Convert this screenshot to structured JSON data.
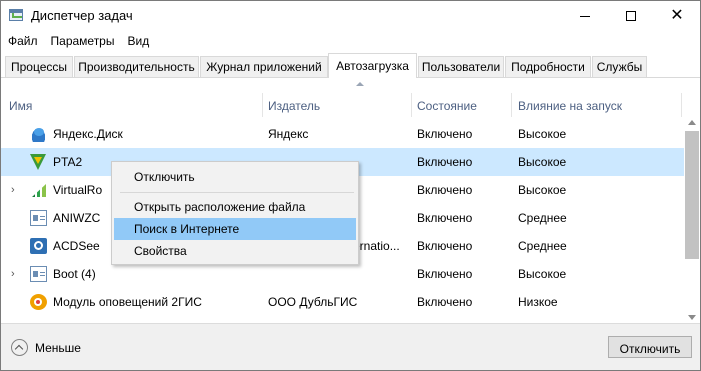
{
  "window": {
    "title": "Диспетчер задач",
    "icon": "task-manager-icon"
  },
  "window_controls": {
    "minimize": "—",
    "maximize": "☐",
    "close": "✕"
  },
  "menu": [
    "Файл",
    "Параметры",
    "Вид"
  ],
  "tabs": [
    {
      "label": "Процессы",
      "active": false
    },
    {
      "label": "Производительность",
      "active": false
    },
    {
      "label": "Журнал приложений",
      "active": false
    },
    {
      "label": "Автозагрузка",
      "active": true
    },
    {
      "label": "Пользователи",
      "active": false
    },
    {
      "label": "Подробности",
      "active": false
    },
    {
      "label": "Службы",
      "active": false
    }
  ],
  "columns": {
    "name": "Имя",
    "publisher": "Издатель",
    "status": "Состояние",
    "impact": "Влияние на запуск"
  },
  "rows": [
    {
      "name": "Яндекс.Диск",
      "publisher": "Яндекс",
      "status": "Включено",
      "impact": "Высокое",
      "icon": "yandex-disk-icon",
      "expandable": false,
      "selected": false
    },
    {
      "name": "PTA2",
      "publisher": "",
      "status": "Включено",
      "impact": "Высокое",
      "icon": "shield-icon",
      "expandable": false,
      "selected": true
    },
    {
      "name": "VirtualRo",
      "publisher": "",
      "status": "Включено",
      "impact": "Высокое",
      "icon": "bars-icon",
      "expandable": true,
      "selected": false
    },
    {
      "name": "ANIWZC",
      "publisher": "",
      "status": "Включено",
      "impact": "Среднее",
      "icon": "window-icon",
      "expandable": false,
      "selected": false
    },
    {
      "name": "ACDSee",
      "publisher": "ernatio...",
      "status": "Включено",
      "impact": "Среднее",
      "icon": "camera-icon",
      "expandable": false,
      "selected": false
    },
    {
      "name": "Boot (4)",
      "publisher": "",
      "status": "Включено",
      "impact": "Высокое",
      "icon": "window-icon",
      "expandable": true,
      "selected": false
    },
    {
      "name": "Модуль оповещений 2ГИС",
      "publisher": "ООО ДубльГИС",
      "status": "Включено",
      "impact": "Низкое",
      "icon": "pin-icon",
      "expandable": false,
      "selected": false
    }
  ],
  "context_menu": {
    "disable": "Отключить",
    "open_location": "Открыть расположение файла",
    "search_online": "Поиск в Интернете",
    "properties": "Свойства"
  },
  "footer": {
    "less_label": "Меньше",
    "disable_button": "Отключить"
  },
  "colors": {
    "selected_row": "#cce8ff",
    "hover_item": "#91c9f7",
    "header_text": "#4d6082"
  }
}
